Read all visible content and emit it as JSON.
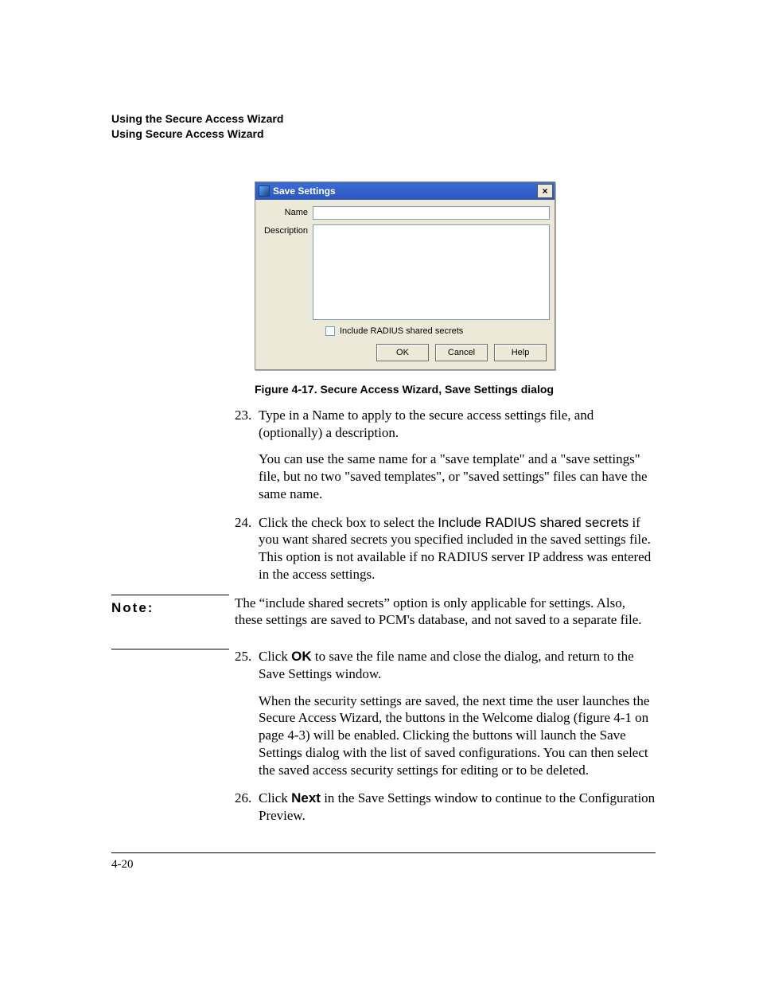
{
  "header": {
    "line1": "Using the Secure Access Wizard",
    "line2": "Using Secure Access Wizard"
  },
  "dialog": {
    "title": "Save Settings",
    "close_glyph": "×",
    "name_label": "Name",
    "desc_label": "Description",
    "checkbox_label": "Include RADIUS shared secrets",
    "ok": "OK",
    "cancel": "Cancel",
    "help": "Help"
  },
  "caption": "Figure 4-17. Secure Access Wizard, Save Settings dialog",
  "steps": {
    "s23": {
      "num": "23.",
      "p1": "Type in a Name to apply to the secure access settings file, and (optionally) a description.",
      "p2": "You can use the same name for a \"save template\" and a \"save settings\" file, but no two \"saved templates\", or \"saved settings\" files can have the same name."
    },
    "s24": {
      "num": "24.",
      "p1a": "Click the check box to select the ",
      "p1b": "Include RADIUS shared secrets",
      "p1c": " if you want shared secrets you specified included in the saved settings file. This option is not available if no RADIUS server IP address was entered in the access settings."
    },
    "s25": {
      "num": "25.",
      "p1a": "Click ",
      "p1b": "OK",
      "p1c": " to save the file name and close the dialog, and return to the Save Settings window.",
      "p2": "When the security settings are saved, the next time the user launches the Secure Access Wizard, the buttons in the Welcome dialog (figure 4-1 on page 4-3) will be enabled. Clicking the buttons will launch the Save Settings dialog with the list of saved configurations. You can then select the saved access security settings for editing or to be deleted."
    },
    "s26": {
      "num": "26.",
      "p1a": "Click ",
      "p1b": "Next",
      "p1c": " in the Save Settings window to continue to the Configuration Preview."
    }
  },
  "note": {
    "label": "Note:",
    "text": "The “include shared secrets” option is only applicable for settings. Also, these settings are saved to PCM's database, and not saved to a separate file."
  },
  "page_number": "4-20"
}
